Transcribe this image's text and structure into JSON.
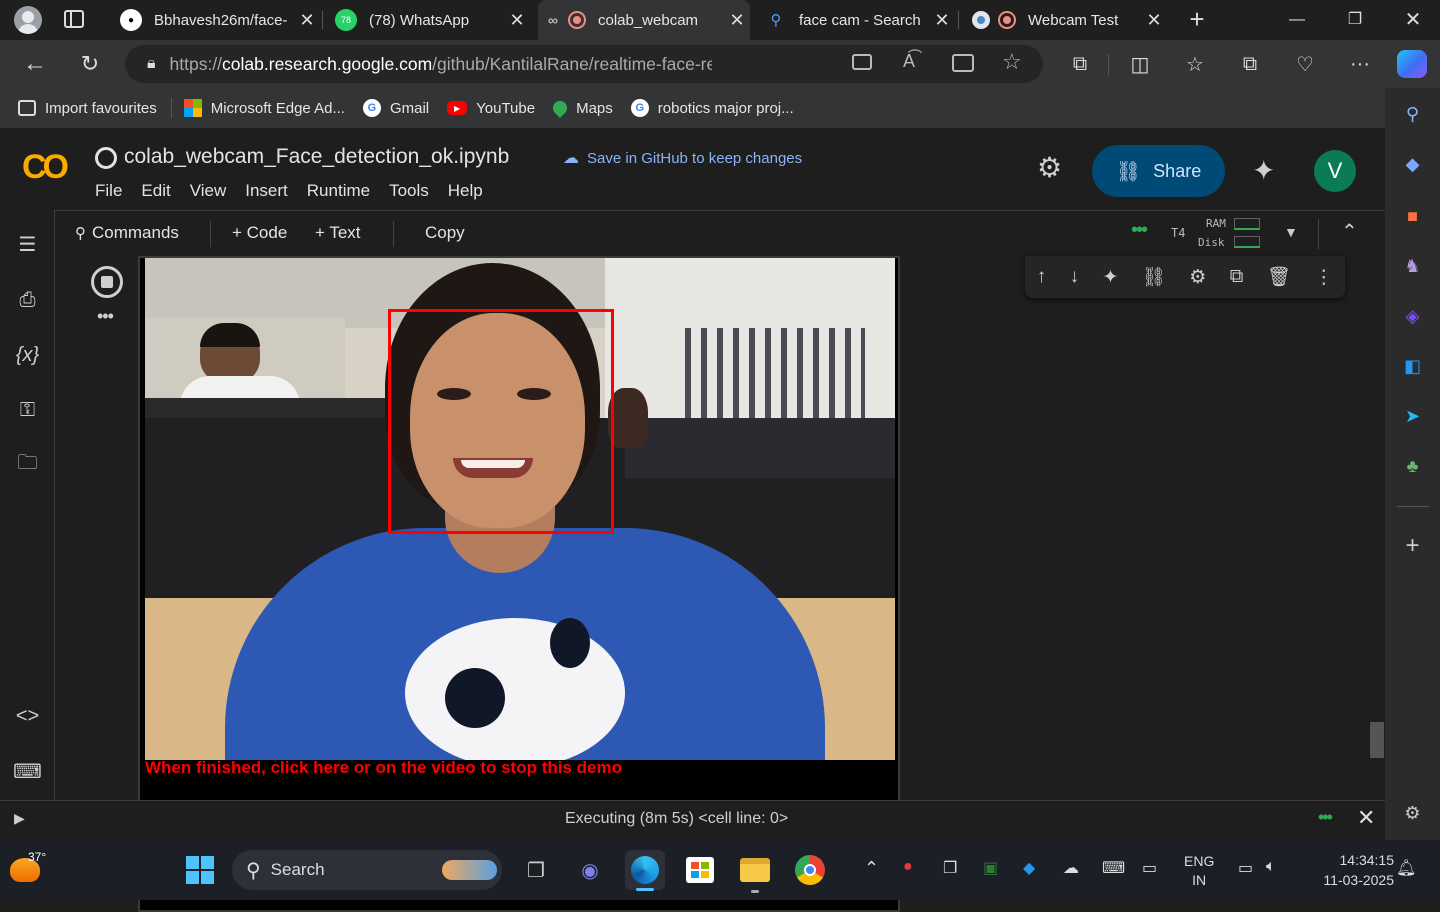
{
  "tabs": [
    {
      "title": "Bbhavesh26m/face-",
      "icon": "github-icon"
    },
    {
      "title": "(78) WhatsApp",
      "badge": "78",
      "icon": "whatsapp-icon"
    },
    {
      "title": "colab_webcam",
      "icon": "colab-icon"
    },
    {
      "title": "face cam - Search",
      "icon": "search-icon"
    },
    {
      "title": "Webcam Test",
      "icon": "globe-icon"
    }
  ],
  "address": {
    "scheme": "https://",
    "host": "colab.research.google.com",
    "path": "/github/KantilalRane/realtime-face-recognition/..."
  },
  "bookmarks": [
    "Import favourites",
    "Microsoft Edge Ad...",
    "Gmail",
    "YouTube",
    "Maps",
    "robotics major proj..."
  ],
  "notification_count": "1",
  "colab": {
    "logo": "CO",
    "notebook_title": "colab_webcam_Face_detection_ok.ipynb",
    "save_github": "Save in GitHub to keep changes",
    "menu": [
      "File",
      "Edit",
      "View",
      "Insert",
      "Runtime",
      "Tools",
      "Help"
    ],
    "share": "Share",
    "avatar": "V",
    "toolbar": {
      "commands": "Commands",
      "code": "+ Code",
      "text": "+ Text",
      "copy": "Copy"
    },
    "runtime": {
      "gpu": "T4",
      "ram": "RAM",
      "disk": "Disk"
    },
    "output_caption": "When finished, click here or on the video to stop this demo",
    "status": "Executing (8m 5s)  <cell line: 0>"
  },
  "taskbar": {
    "weather": "37°",
    "search": "Search",
    "lang": "ENG",
    "region": "IN",
    "time": "14:34:15",
    "date": "11-03-2025"
  },
  "colors": {
    "accent": "#004a77",
    "avatar": "#0b7a57",
    "face_box": "#ff0000",
    "caption": "#ff0000"
  }
}
